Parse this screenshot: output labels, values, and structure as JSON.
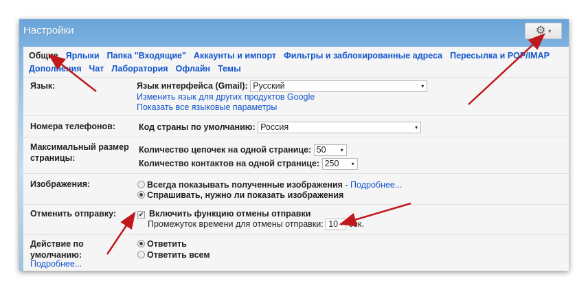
{
  "window": {
    "title": "Настройки",
    "gear_icon": "gear-icon",
    "caret": "▾"
  },
  "tabs": [
    {
      "label": "Общие",
      "active": true
    },
    {
      "label": "Ярлыки"
    },
    {
      "label": "Папка \"Входящие\""
    },
    {
      "label": "Аккаунты и импорт"
    },
    {
      "label": "Фильтры и заблокированные адреса"
    },
    {
      "label": "Пересылка и POP/IMAP"
    },
    {
      "label": "Дополнения"
    },
    {
      "label": "Чат"
    },
    {
      "label": "Лаборатория"
    },
    {
      "label": "Офлайн"
    },
    {
      "label": "Темы"
    }
  ],
  "language": {
    "label": "Язык:",
    "field_label": "Язык интерфейса (Gmail):",
    "value": "Русский",
    "link1": "Изменить язык для других продуктов Google",
    "link2": "Показать все языковые параметры"
  },
  "phones": {
    "label": "Номера телефонов:",
    "field_label": "Код страны по умолчанию:",
    "value": "Россия"
  },
  "page_size": {
    "label": "Максимальный размер страницы:",
    "threads_label": "Количество цепочек на одной странице:",
    "threads_value": "50",
    "contacts_label": "Количество контактов на одной странице:",
    "contacts_value": "250"
  },
  "images": {
    "label": "Изображения:",
    "opt1": "Всегда показывать полученные изображения",
    "opt1_sep": " - ",
    "opt1_link": "Подробнее...",
    "opt2": "Спрашивать, нужно ли показать изображения",
    "selected": 2
  },
  "undo_send": {
    "label": "Отменить отправку:",
    "checkbox_label": "Включить функцию отмены отправки",
    "checked": true,
    "period_label": "Промежуток времени для отмены отправки:",
    "period_value": "10",
    "unit": "сек."
  },
  "default_reply": {
    "label": "Действие по умолчанию:",
    "more_link": "Подробнее...",
    "opt1": "Ответить",
    "opt2": "Ответить всем"
  },
  "annotation_color": "#c0181b"
}
